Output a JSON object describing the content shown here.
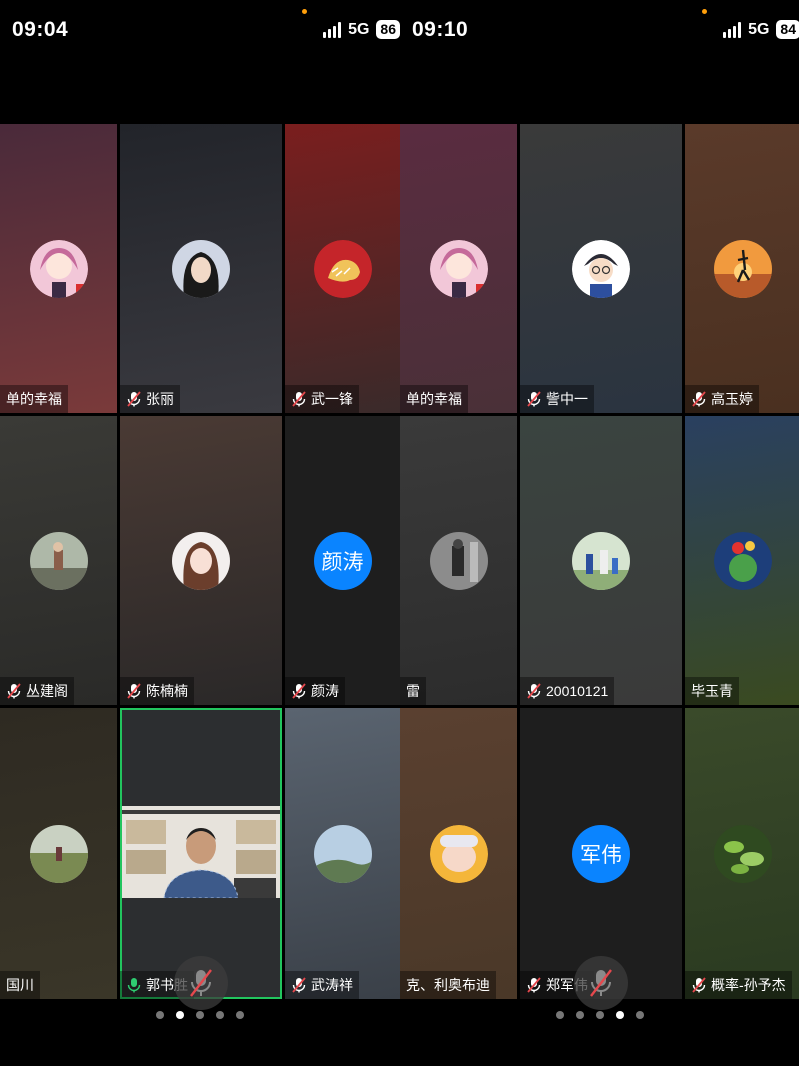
{
  "left": {
    "status": {
      "time": "09:04",
      "network": "5G",
      "battery": "86"
    },
    "tiles": [
      {
        "name": "单的幸福",
        "mic": "none",
        "bg": [
          "#4a2a3a",
          "#7a3a3a"
        ],
        "avatar": "anime-girl"
      },
      {
        "name": "张丽",
        "mic": "muted",
        "bg": [
          "#22242a",
          "#3a3a40"
        ],
        "avatar": "woman-photo"
      },
      {
        "name": "武一锋",
        "mic": "muted",
        "bg": [
          "#7a1e1e",
          "#3a2a2a"
        ],
        "avatar": "tiger"
      },
      {
        "name": "丛建阁",
        "mic": "muted",
        "bg": [
          "#3a3a36",
          "#2a2a28"
        ],
        "avatar": "outdoor-photo"
      },
      {
        "name": "陈楠楠",
        "mic": "muted",
        "bg": [
          "#4a3a34",
          "#2a2828"
        ],
        "avatar": "doll-girl"
      },
      {
        "name": "颜涛",
        "mic": "muted",
        "bg": [
          "#1e1e1e",
          "#1e1e1e"
        ],
        "initials": "颜涛"
      },
      {
        "name": "国川",
        "mic": "none",
        "bg": [
          "#2e2a22",
          "#3a3628"
        ],
        "avatar": "field-photo"
      },
      {
        "name": "郭书胜",
        "mic": "speaking",
        "bg": [
          "#2c2e30",
          "#2c2e30"
        ],
        "avatar": "camera",
        "active": true
      },
      {
        "name": "武涛祥",
        "mic": "muted",
        "bg": [
          "#5a6470",
          "#3a4048"
        ],
        "avatar": "sky-photo"
      }
    ],
    "pager": {
      "count": 5,
      "active": 1
    }
  },
  "right": {
    "status": {
      "time": "09:10",
      "network": "5G",
      "battery": "84"
    },
    "tiles": [
      {
        "name": "单的幸福",
        "mic": "none",
        "bg": [
          "#5a2c40",
          "#4a3038"
        ],
        "avatar": "anime-girl"
      },
      {
        "name": "訾中一",
        "mic": "muted",
        "bg": [
          "#3a3a3a",
          "#2a3440"
        ],
        "avatar": "cartoon-boy"
      },
      {
        "name": "高玉婷",
        "mic": "muted",
        "bg": [
          "#5a3a2a",
          "#4a3020"
        ],
        "avatar": "sunset-yoga"
      },
      {
        "name": "雷",
        "mic": "none",
        "bg": [
          "#3a3a3a",
          "#2c2c2c"
        ],
        "avatar": "bw-man"
      },
      {
        "name": "20010121",
        "mic": "muted",
        "bg": [
          "#3a4440",
          "#3a3a3a"
        ],
        "avatar": "family-photo"
      },
      {
        "name": "毕玉青",
        "mic": "none",
        "bg": [
          "#2a4060",
          "#3a4a20"
        ],
        "avatar": "flower-globe"
      },
      {
        "name": "克、利奥布迪",
        "mic": "none",
        "bg": [
          "#5a4030",
          "#4a3828"
        ],
        "avatar": "baby-photo"
      },
      {
        "name": "郑军伟",
        "mic": "muted",
        "bg": [
          "#1e1e1e",
          "#1e1e1e"
        ],
        "initials": "军伟"
      },
      {
        "name": "概率-孙予杰",
        "mic": "muted",
        "bg": [
          "#3a4a2a",
          "#2a3a20"
        ],
        "avatar": "leaves-photo"
      }
    ],
    "pager": {
      "count": 5,
      "active": 3
    }
  },
  "colors": {
    "accent": "#0a84ff",
    "active_border": "#22c55e"
  }
}
